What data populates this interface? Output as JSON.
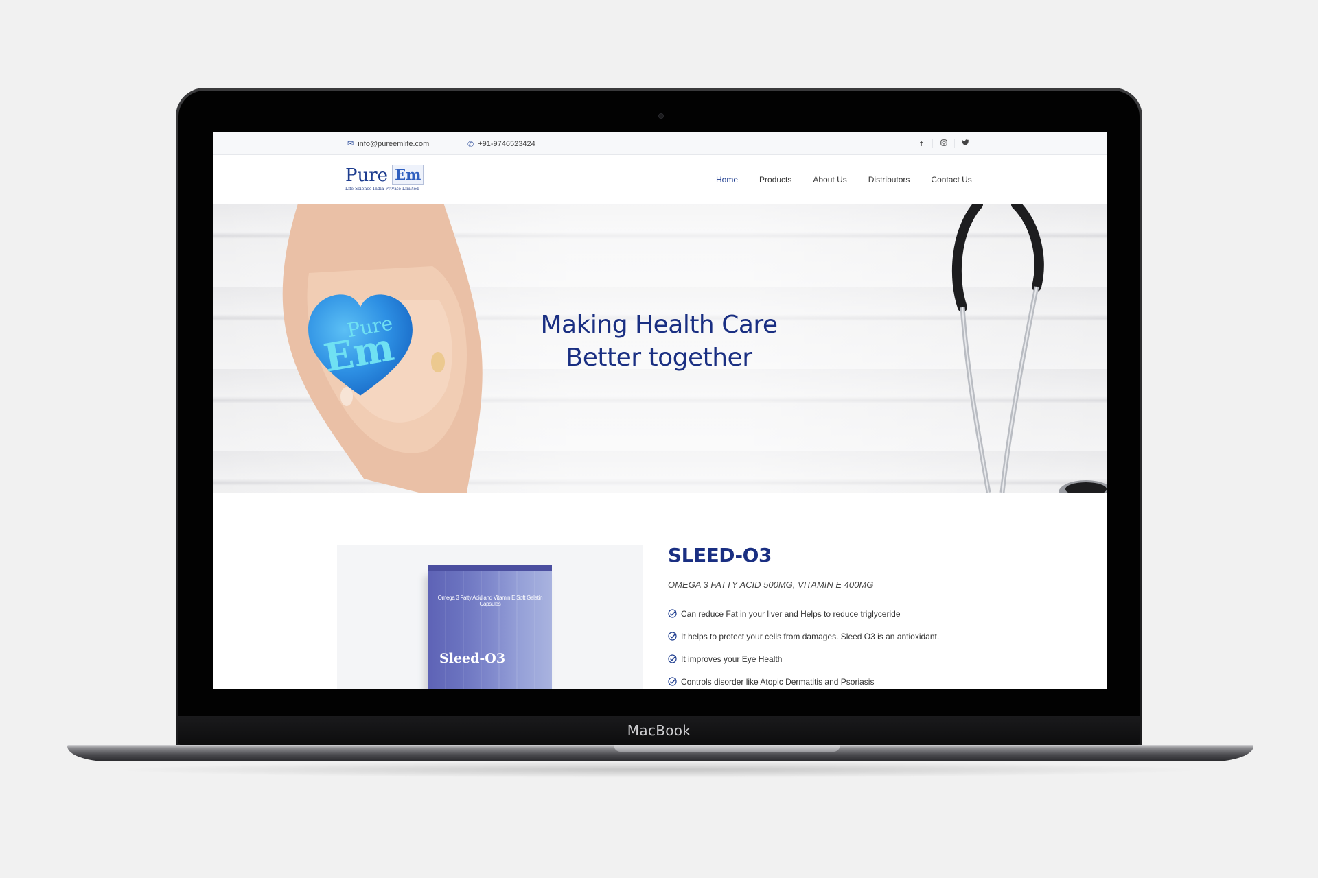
{
  "device": {
    "brand_label": "MacBook"
  },
  "topbar": {
    "email": "info@pureemlife.com",
    "phone": "+91-9746523424",
    "email_icon": "envelope-icon",
    "phone_icon": "phone-icon",
    "social": [
      {
        "name": "facebook-icon",
        "glyph": "f"
      },
      {
        "name": "instagram-icon",
        "glyph": "◎"
      },
      {
        "name": "twitter-icon",
        "glyph": "🐦"
      }
    ]
  },
  "logo": {
    "word1": "Pure",
    "word2": "Em",
    "tagline": "Life Science India Private Limited"
  },
  "nav": {
    "items": [
      "Home",
      "Products",
      "About Us",
      "Distributors",
      "Contact Us"
    ],
    "active": "Home"
  },
  "hero": {
    "title_line1": "Making Health Care",
    "title_line2": "Better together",
    "heart_word1": "Pure",
    "heart_word2": "Em"
  },
  "product": {
    "box_description": "Omega 3 Fatty Acid and Vitamin E Soft Gelatin Capsules",
    "box_name": "Sleed-O3",
    "title": "SLEED-O3",
    "subtitle": "OMEGA 3 FATTY ACID 500MG, VITAMIN E 400MG",
    "features": [
      "Can reduce Fat in your liver and Helps to reduce triglyceride",
      "It helps to protect your cells from damages. Sleed O3 is an antioxidant.",
      "It improves your Eye Health",
      "Controls disorder like Atopic Dermatitis and Psoriasis"
    ]
  },
  "colors": {
    "brand_navy": "#1a2f82",
    "accent_blue": "#2f5fbf",
    "heart_blue": "#2d9be8",
    "box_purple": "#6a72bf"
  }
}
